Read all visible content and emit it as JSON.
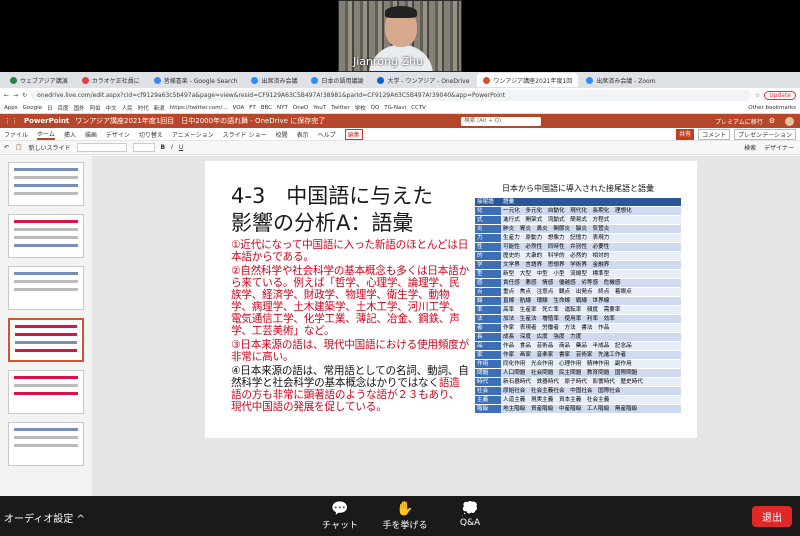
{
  "video": {
    "name": "Jianrong Zhu"
  },
  "browser": {
    "tabs": [
      {
        "label": "ウェブアジア講演",
        "color": "#2d7d46"
      },
      {
        "label": "カラオケ正社員に",
        "color": "#e04040"
      },
      {
        "label": "皆様喜楽 - Google Search",
        "color": "#4285f4"
      },
      {
        "label": "出席済み会議",
        "color": "#2d8cff"
      },
      {
        "label": "日本の語用議論",
        "color": "#2d8cff"
      },
      {
        "label": "大学 - ワンアジア - OneDrive",
        "color": "#0a64c8"
      },
      {
        "label": "ワンアジア講座2021年度1回",
        "color": "#d35230"
      },
      {
        "label": "出席済み会議 - Zoom",
        "color": "#2d8cff"
      }
    ],
    "url": "onedrive.live.com/edit.aspx?cid=cf9129a63c5b497a&page=view&resid=CF9129A63C5B497A!38981&parId=CF9129A63C5B497A!39040&app=PowerPoint",
    "update_label": "Update",
    "bookmarks": [
      "Apps",
      "Google",
      "日",
      "百度",
      "国外",
      "阿伯",
      "中文",
      "人民",
      "时代",
      "新浪",
      "https://twitter.com/...",
      "VOA",
      "FT",
      "BBC",
      "NYT",
      "OneD",
      "YouT",
      "Twitter",
      "学校",
      "QQ",
      "TG-Navi",
      "CCTV"
    ],
    "bookmarks_right": "Other bookmarks"
  },
  "office": {
    "app": "PowerPoint",
    "doc_title": "ワンアジア講座2021年度1回目　日中2000年の語れ舞 - OneDrive に保存完了",
    "search_placeholder": "検索 (Alt + Q)",
    "premium": "プレミアムに移行",
    "menu": [
      "ファイル",
      "ホーム",
      "挿入",
      "描画",
      "デザイン",
      "切り替え",
      "アニメーション",
      "スライド ショー",
      "校閲",
      "表示",
      "ヘルプ"
    ],
    "edit_label": "編集",
    "share_label": "共有",
    "comment_label": "コメント",
    "present_label": "プレゼンテーション",
    "ribbon_left": [
      "新しいスライド"
    ],
    "ribbon_right": [
      "検索",
      "デザイナー"
    ]
  },
  "slide": {
    "title_line1": "4-3　中国語に与えた",
    "title_line2": "影響の分析A：語彙",
    "para1": "①近代になって中国語に入った新語のほとんどは日本語からである。",
    "para2": "②自然科学や社会科学の基本概念も多くは日本語から来ている。例えば「哲学、心理学、論理学、民族学、経済学、財政学、物理学、衛生学、動物学、病理学、土木建築学、土木工学、河川工学、電気通信工学、化学工業、薄記、冶金、鋼鉄、声学、工芸美術」など。",
    "para3": "③日本来源の語は、現代中国語における使用頻度が非常に高い。",
    "para4a": "④日本来源の語は、常用語としての名詞、動詞、自然科学と社会科学の基本概念はかりではなく",
    "para4b": "語造語の方も非常に顕著語のような語が２３もあり、現代中国語の発展を促している。",
    "table_title": "日本から中国語に導入された接尾語と語彙",
    "table_head": [
      "接尾語",
      "語彙"
    ],
    "table_rows": [
      [
        "化",
        "一元化　多元化　自動化　現代化　長期化　理想化"
      ],
      [
        "式",
        "進行式　開架式　流動式　簡易式　方程式"
      ],
      [
        "炎",
        "肺炎　胃炎　鼻炎　関節炎　脳炎　気管炎"
      ],
      [
        "力",
        "生産力　原動力　想像力　記憶力　表現力"
      ],
      [
        "性",
        "可能性　必然性　同時性　弁別性　必要性"
      ],
      [
        "的",
        "歴史的　大衆的　科学的　必然的　相対的"
      ],
      [
        "学",
        "文学界　言語界　思想界　学術界　金融界"
      ],
      [
        "型",
        "新型　大型　中型　小型　流線型　標準型"
      ],
      [
        "感",
        "責任感　悪感　情感　優越感　劣等感　危機感"
      ],
      [
        "点",
        "重点　焦点　注意点　観点　出発点　終点　着眼点"
      ],
      [
        "線",
        "直線　航線　環線　生命線　戦線　世界線"
      ],
      [
        "率",
        "高率　生産率　死亡率　運転率　頻度　需要率"
      ],
      [
        "法",
        "加法　生産法　増殖率　使用率　利率　効率"
      ],
      [
        "者",
        "作家　表現者　労働者　方法　書法　作品"
      ],
      [
        "長",
        "成長　深度　広度　強度　力度"
      ],
      [
        "品",
        "作品　食品　芸術品　商品　藥品　半成品　記念品"
      ],
      [
        "家",
        "作家　画家　音楽家　書家　芸術家　先進工作者"
      ],
      [
        "作用",
        "同化作用　光合作用　心理作用　精神作用　副作用"
      ],
      [
        "問題",
        "人口問題　社会問題　民主問題　教育問題　国際問題"
      ],
      [
        "時代",
        "新石器時代　鉄器時代　原子時代　影響時代　歴史時代"
      ],
      [
        "社会",
        "原始社会　社会主義社会　中国社会　国際社会"
      ],
      [
        "主義",
        "人道主義　現実主義　資本主義　社会主義"
      ],
      [
        "階級",
        "地主階級　資産階級　中産階級　工人階級　無産階級"
      ]
    ]
  },
  "zoom": {
    "audio_label": "オーディオ設定",
    "chat_label": "チャット",
    "raise_label": "手を挙げる",
    "qa_label": "Q&A",
    "leave_label": "退出"
  }
}
